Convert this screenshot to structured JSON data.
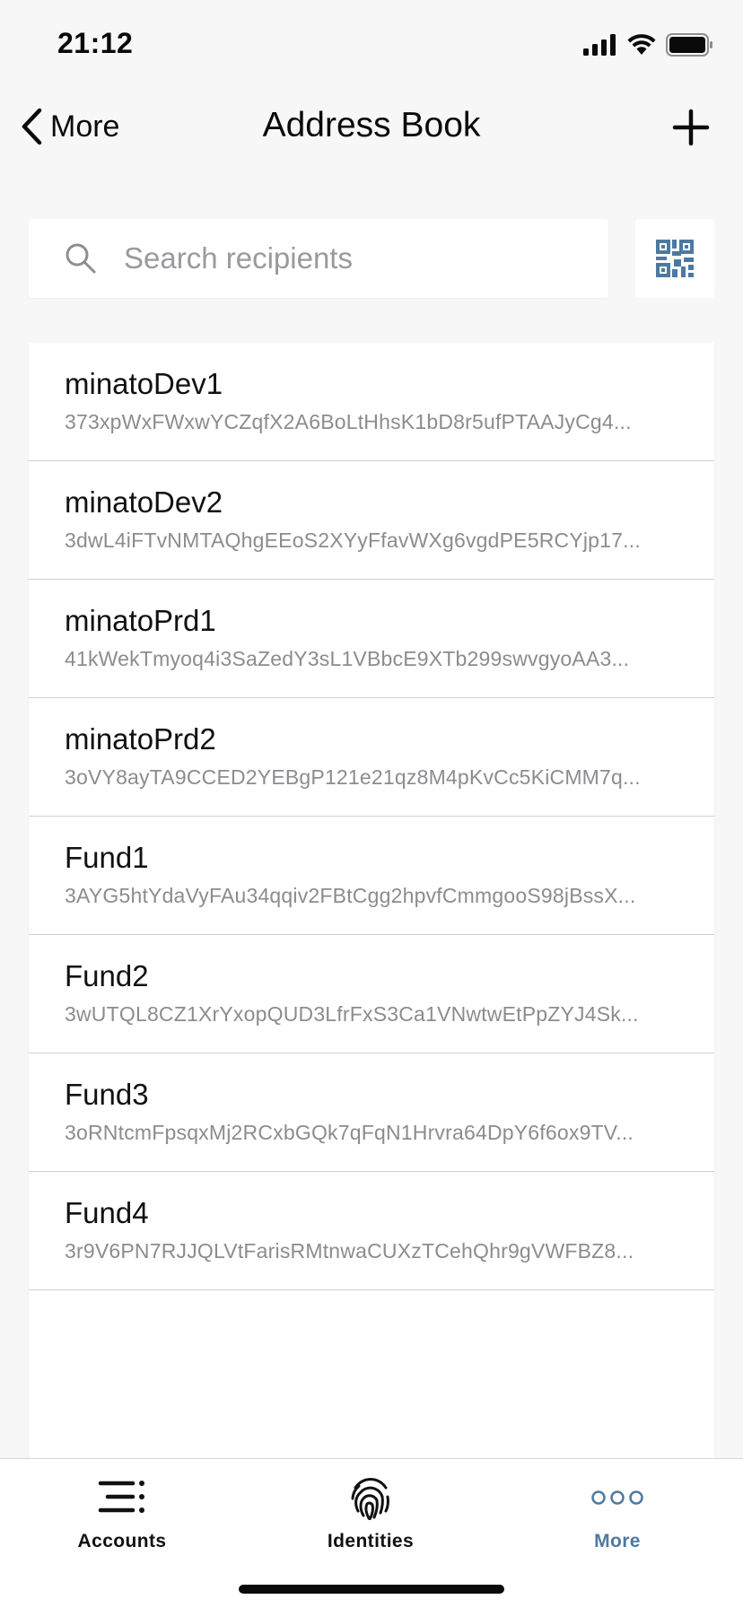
{
  "status_bar": {
    "time": "21:12",
    "icons": [
      "signal-icon",
      "wifi-icon",
      "battery-icon"
    ]
  },
  "nav": {
    "back_label": "More",
    "title": "Address Book",
    "back_icon": "chevron-left-icon",
    "add_icon": "plus-icon"
  },
  "search": {
    "placeholder": "Search recipients",
    "value": "",
    "icon": "search-icon",
    "qr_icon": "qr-code-icon"
  },
  "recipients": [
    {
      "name": "minatoDev1",
      "address": "373xpWxFWxwYCZqfX2A6BoLtHhsK1bD8r5ufPTAAJyCg4..."
    },
    {
      "name": "minatoDev2",
      "address": "3dwL4iFTvNMTAQhgEEoS2XYyFfavWXg6vgdPE5RCYjp17..."
    },
    {
      "name": "minatoPrd1",
      "address": "41kWekTmyoq4i3SaZedY3sL1VBbcE9XTb299swvgyoAA3..."
    },
    {
      "name": "minatoPrd2",
      "address": "3oVY8ayTA9CCED2YEBgP121e21qz8M4pKvCc5KiCMM7q..."
    },
    {
      "name": "Fund1",
      "address": "3AYG5htYdaVyFAu34qqiv2FBtCgg2hpvfCmmgooS98jBssX..."
    },
    {
      "name": "Fund2",
      "address": "3wUTQL8CZ1XrYxopQUD3LfrFxS3Ca1VNwtwEtPpZYJ4Sk..."
    },
    {
      "name": "Fund3",
      "address": "3oRNtcmFpsqxMj2RCxbGQk7qFqN1Hrvra64DpY6f6ox9TV..."
    },
    {
      "name": "Fund4",
      "address": "3r9V6PN7RJJQLVtFarisRMtnwaCUXzTCehQhr9gVWFBZ8..."
    }
  ],
  "tab_bar": {
    "tabs": [
      {
        "label": "Accounts",
        "icon": "accounts-list-icon",
        "active": false
      },
      {
        "label": "Identities",
        "icon": "fingerprint-icon",
        "active": false
      },
      {
        "label": "More",
        "icon": "more-dots-icon",
        "active": true
      }
    ]
  },
  "colors": {
    "accent": "#4d79a1",
    "background": "#f7f7f8",
    "card": "#ffffff",
    "secondary_text": "#8c8c90"
  }
}
